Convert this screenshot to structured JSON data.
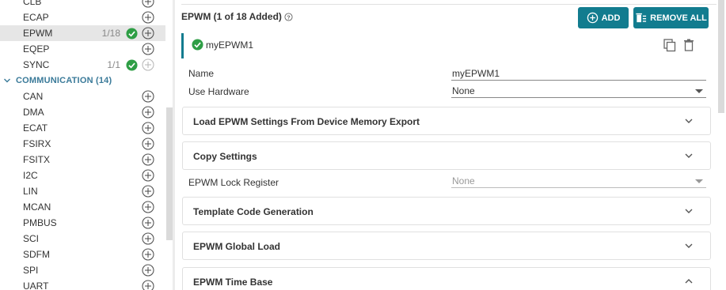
{
  "sidebar": {
    "items_top": [
      {
        "label": "CLB",
        "count": "",
        "added": false,
        "disabled": false,
        "selected": false
      },
      {
        "label": "ECAP",
        "count": "",
        "added": false,
        "disabled": false,
        "selected": false
      },
      {
        "label": "EPWM",
        "count": "1/18",
        "added": true,
        "disabled": false,
        "selected": true
      },
      {
        "label": "EQEP",
        "count": "",
        "added": false,
        "disabled": false,
        "selected": false
      },
      {
        "label": "SYNC",
        "count": "1/1",
        "added": true,
        "disabled": true,
        "selected": false
      }
    ],
    "category": {
      "label": "COMMUNICATION (14)",
      "expanded": true
    },
    "items_comm": [
      {
        "label": "CAN"
      },
      {
        "label": "DMA"
      },
      {
        "label": "ECAT"
      },
      {
        "label": "FSIRX"
      },
      {
        "label": "FSITX"
      },
      {
        "label": "I2C"
      },
      {
        "label": "LIN"
      },
      {
        "label": "MCAN"
      },
      {
        "label": "PMBUS"
      },
      {
        "label": "SCI"
      },
      {
        "label": "SDFM"
      },
      {
        "label": "SPI"
      },
      {
        "label": "UART"
      }
    ]
  },
  "panel": {
    "title": "EPWM (1 of 18 Added)",
    "add_label": "ADD",
    "remove_label": "REMOVE ALL",
    "instance_name": "myEPWM1"
  },
  "fields": {
    "name_label": "Name",
    "name_value": "myEPWM1",
    "hardware_label": "Use Hardware",
    "hardware_value": "None",
    "lock_label": "EPWM Lock Register",
    "lock_value": "None"
  },
  "sections": {
    "load_settings": "Load EPWM Settings From Device Memory Export",
    "copy_settings": "Copy Settings",
    "template_code": "Template Code Generation",
    "global_load": "EPWM Global Load",
    "time_base": "EPWM Time Base"
  },
  "colors": {
    "accent": "#127c8f",
    "success": "#2e9e45",
    "category": "#3a7a99"
  }
}
